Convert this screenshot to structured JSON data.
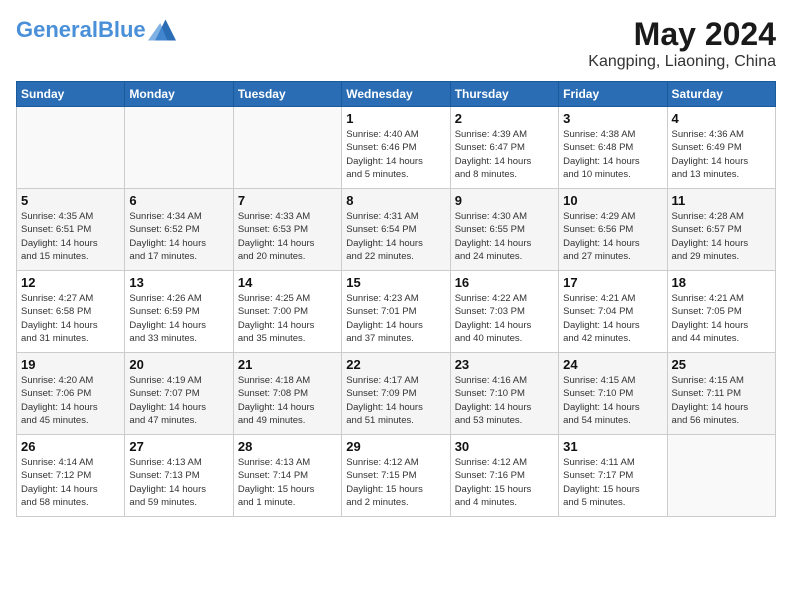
{
  "header": {
    "logo_general": "General",
    "logo_blue": "Blue",
    "month": "May 2024",
    "location": "Kangping, Liaoning, China"
  },
  "weekdays": [
    "Sunday",
    "Monday",
    "Tuesday",
    "Wednesday",
    "Thursday",
    "Friday",
    "Saturday"
  ],
  "weeks": [
    [
      {
        "day": "",
        "info": ""
      },
      {
        "day": "",
        "info": ""
      },
      {
        "day": "",
        "info": ""
      },
      {
        "day": "1",
        "info": "Sunrise: 4:40 AM\nSunset: 6:46 PM\nDaylight: 14 hours\nand 5 minutes."
      },
      {
        "day": "2",
        "info": "Sunrise: 4:39 AM\nSunset: 6:47 PM\nDaylight: 14 hours\nand 8 minutes."
      },
      {
        "day": "3",
        "info": "Sunrise: 4:38 AM\nSunset: 6:48 PM\nDaylight: 14 hours\nand 10 minutes."
      },
      {
        "day": "4",
        "info": "Sunrise: 4:36 AM\nSunset: 6:49 PM\nDaylight: 14 hours\nand 13 minutes."
      }
    ],
    [
      {
        "day": "5",
        "info": "Sunrise: 4:35 AM\nSunset: 6:51 PM\nDaylight: 14 hours\nand 15 minutes."
      },
      {
        "day": "6",
        "info": "Sunrise: 4:34 AM\nSunset: 6:52 PM\nDaylight: 14 hours\nand 17 minutes."
      },
      {
        "day": "7",
        "info": "Sunrise: 4:33 AM\nSunset: 6:53 PM\nDaylight: 14 hours\nand 20 minutes."
      },
      {
        "day": "8",
        "info": "Sunrise: 4:31 AM\nSunset: 6:54 PM\nDaylight: 14 hours\nand 22 minutes."
      },
      {
        "day": "9",
        "info": "Sunrise: 4:30 AM\nSunset: 6:55 PM\nDaylight: 14 hours\nand 24 minutes."
      },
      {
        "day": "10",
        "info": "Sunrise: 4:29 AM\nSunset: 6:56 PM\nDaylight: 14 hours\nand 27 minutes."
      },
      {
        "day": "11",
        "info": "Sunrise: 4:28 AM\nSunset: 6:57 PM\nDaylight: 14 hours\nand 29 minutes."
      }
    ],
    [
      {
        "day": "12",
        "info": "Sunrise: 4:27 AM\nSunset: 6:58 PM\nDaylight: 14 hours\nand 31 minutes."
      },
      {
        "day": "13",
        "info": "Sunrise: 4:26 AM\nSunset: 6:59 PM\nDaylight: 14 hours\nand 33 minutes."
      },
      {
        "day": "14",
        "info": "Sunrise: 4:25 AM\nSunset: 7:00 PM\nDaylight: 14 hours\nand 35 minutes."
      },
      {
        "day": "15",
        "info": "Sunrise: 4:23 AM\nSunset: 7:01 PM\nDaylight: 14 hours\nand 37 minutes."
      },
      {
        "day": "16",
        "info": "Sunrise: 4:22 AM\nSunset: 7:03 PM\nDaylight: 14 hours\nand 40 minutes."
      },
      {
        "day": "17",
        "info": "Sunrise: 4:21 AM\nSunset: 7:04 PM\nDaylight: 14 hours\nand 42 minutes."
      },
      {
        "day": "18",
        "info": "Sunrise: 4:21 AM\nSunset: 7:05 PM\nDaylight: 14 hours\nand 44 minutes."
      }
    ],
    [
      {
        "day": "19",
        "info": "Sunrise: 4:20 AM\nSunset: 7:06 PM\nDaylight: 14 hours\nand 45 minutes."
      },
      {
        "day": "20",
        "info": "Sunrise: 4:19 AM\nSunset: 7:07 PM\nDaylight: 14 hours\nand 47 minutes."
      },
      {
        "day": "21",
        "info": "Sunrise: 4:18 AM\nSunset: 7:08 PM\nDaylight: 14 hours\nand 49 minutes."
      },
      {
        "day": "22",
        "info": "Sunrise: 4:17 AM\nSunset: 7:09 PM\nDaylight: 14 hours\nand 51 minutes."
      },
      {
        "day": "23",
        "info": "Sunrise: 4:16 AM\nSunset: 7:10 PM\nDaylight: 14 hours\nand 53 minutes."
      },
      {
        "day": "24",
        "info": "Sunrise: 4:15 AM\nSunset: 7:10 PM\nDaylight: 14 hours\nand 54 minutes."
      },
      {
        "day": "25",
        "info": "Sunrise: 4:15 AM\nSunset: 7:11 PM\nDaylight: 14 hours\nand 56 minutes."
      }
    ],
    [
      {
        "day": "26",
        "info": "Sunrise: 4:14 AM\nSunset: 7:12 PM\nDaylight: 14 hours\nand 58 minutes."
      },
      {
        "day": "27",
        "info": "Sunrise: 4:13 AM\nSunset: 7:13 PM\nDaylight: 14 hours\nand 59 minutes."
      },
      {
        "day": "28",
        "info": "Sunrise: 4:13 AM\nSunset: 7:14 PM\nDaylight: 15 hours\nand 1 minute."
      },
      {
        "day": "29",
        "info": "Sunrise: 4:12 AM\nSunset: 7:15 PM\nDaylight: 15 hours\nand 2 minutes."
      },
      {
        "day": "30",
        "info": "Sunrise: 4:12 AM\nSunset: 7:16 PM\nDaylight: 15 hours\nand 4 minutes."
      },
      {
        "day": "31",
        "info": "Sunrise: 4:11 AM\nSunset: 7:17 PM\nDaylight: 15 hours\nand 5 minutes."
      },
      {
        "day": "",
        "info": ""
      }
    ]
  ]
}
